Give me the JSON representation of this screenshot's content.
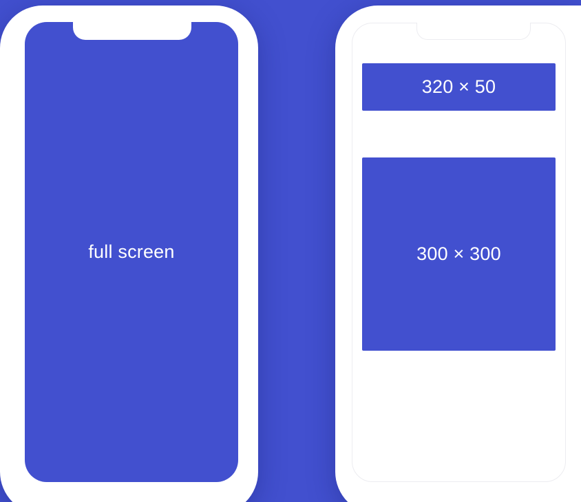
{
  "background_color": "#4250cf",
  "phones": {
    "left": {
      "screen_label": "full screen"
    },
    "right": {
      "banner_label": "320 × 50",
      "square_label": "300 × 300"
    }
  },
  "colors": {
    "accent": "#4250cf",
    "frame": "#ffffff",
    "text": "#ffffff"
  }
}
